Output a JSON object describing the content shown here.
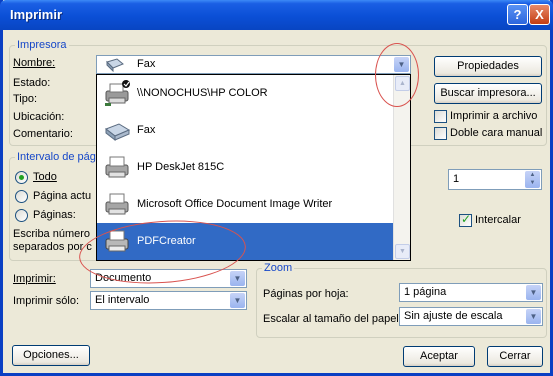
{
  "dialog": {
    "title": "Imprimir",
    "help_glyph": "?",
    "close_glyph": "X"
  },
  "printer": {
    "legend": "Impresora",
    "name_label": "Nombre:",
    "status_label": "Estado:",
    "type_label": "Tipo:",
    "location_label": "Ubicación:",
    "comment_label": "Comentario:",
    "selected_name": "Fax",
    "properties_button": "Propiedades",
    "find_printer_button": "Buscar impresora...",
    "print_to_file_label": "Imprimir a archivo",
    "duplex_label": "Doble cara manual",
    "print_to_file_checked": false,
    "duplex_checked": false
  },
  "printer_list": {
    "items": [
      {
        "label": "\\\\NONOCHUS\\HP COLOR",
        "icon": "network-printer-icon",
        "selected": false
      },
      {
        "label": "Fax",
        "icon": "fax-icon",
        "selected": false
      },
      {
        "label": "HP DeskJet 815C",
        "icon": "printer-icon",
        "selected": false
      },
      {
        "label": "Microsoft Office Document Image Writer",
        "icon": "printer-icon",
        "selected": false
      },
      {
        "label": "PDFCreator",
        "icon": "printer-icon",
        "selected": true
      }
    ]
  },
  "range": {
    "legend": "Intervalo de pág",
    "all_label": "Todo",
    "current_label": "Página actu",
    "pages_label": "Páginas:",
    "hint_line1": "Escriba número",
    "hint_line2": "separados por c",
    "selected": "all"
  },
  "copies": {
    "count": "1",
    "collate_label": "Intercalar",
    "collate_checked": true
  },
  "print_what": {
    "label": "Imprimir:",
    "value": "Documento",
    "only_label": "Imprimir sólo:",
    "only_value": "El intervalo"
  },
  "zoom": {
    "legend": "Zoom",
    "pages_per_sheet_label": "Páginas por hoja:",
    "pages_per_sheet_value": "1 página",
    "scale_label": "Escalar al tamaño del papel:",
    "scale_value": "Sin ajuste de escala"
  },
  "footer": {
    "options_button": "Opciones...",
    "ok_button": "Aceptar",
    "cancel_button": "Cerrar"
  },
  "colors": {
    "title_bar": "#0b4fd6",
    "selection": "#316ac5",
    "annotation": "#d9534f"
  }
}
